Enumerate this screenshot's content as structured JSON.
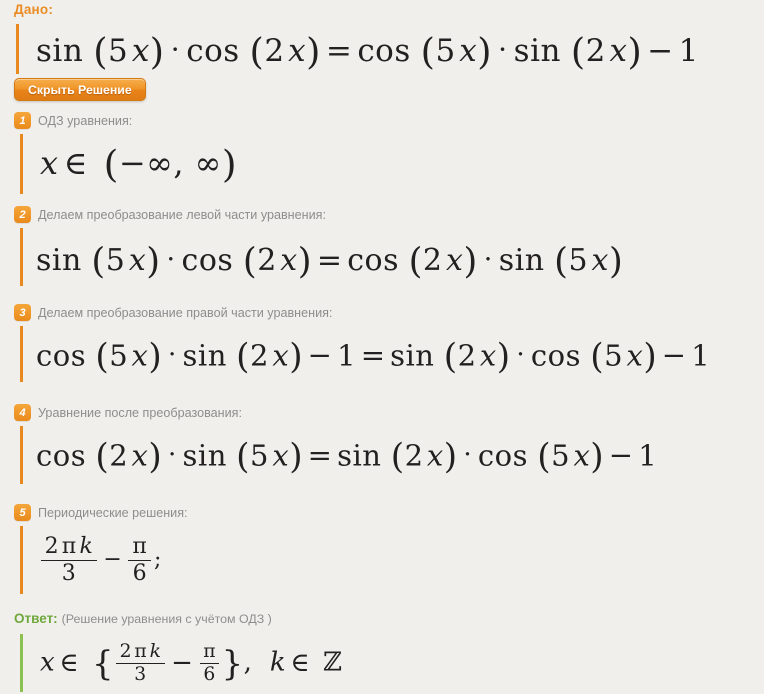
{
  "page": {
    "background_color": "#f1efeb",
    "accent_orange": "#e8891f",
    "accent_green": "#8cc152",
    "text_gray": "#8d8d8d"
  },
  "given": {
    "label": "Дано:",
    "equation": "sin (5 x) · cos (2 x) = cos (5 x) · sin (2 x) − 1"
  },
  "toolbar": {
    "hide_solution_label": "Скрыть Решение"
  },
  "steps": [
    {
      "number": "1",
      "title": "ОДЗ уравнения:",
      "formula": "x ∈ (−∞, ∞)"
    },
    {
      "number": "2",
      "title": "Делаем преобразование левой части уравнения:",
      "formula": "sin (5 x) · cos (2 x) = cos (2 x) · sin (5 x)"
    },
    {
      "number": "3",
      "title": "Делаем преобразование правой части уравнения:",
      "formula": "cos (5 x) · sin (2 x) − 1 = sin (2 x) · cos (5 x) − 1"
    },
    {
      "number": "4",
      "title": "Уравнение после преобразования:",
      "formula": "cos (2 x) · sin (5 x) = sin (2 x) · cos (5 x) − 1"
    },
    {
      "number": "5",
      "title": "Периодические решения:",
      "formula": "2 π k / 3 − π / 6 ;"
    }
  ],
  "answer": {
    "label": "Ответ:",
    "note": "(Решение уравнения с учётом ОДЗ )",
    "formula": "x ∈ { 2 π k / 3 − π / 6 }, k ∈ ℤ"
  },
  "symbols": {
    "x": "x",
    "k": "k",
    "pi": "π",
    "in": "∈",
    "infinity": "∞",
    "minus": "−",
    "equals": "=",
    "dot": "·",
    "comma": ",",
    "semicolon": ";",
    "integers": "ℤ",
    "lparen": "(",
    "rparen": ")",
    "lbrace": "{",
    "rbrace": "}",
    "sin": "sin",
    "cos": "cos",
    "one": "1",
    "two": "2",
    "three": "3",
    "five": "5",
    "six": "6"
  }
}
